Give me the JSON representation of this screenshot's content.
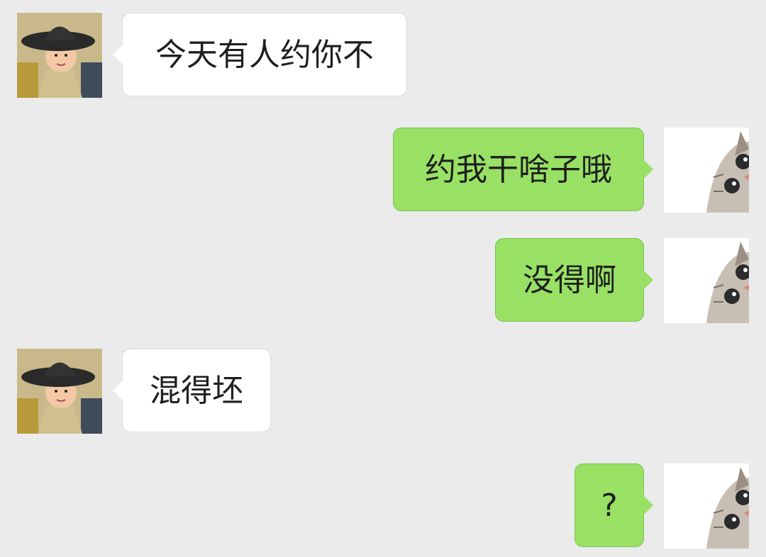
{
  "colors": {
    "background": "#ebebeb",
    "incoming_bubble": "#ffffff",
    "outgoing_bubble": "#98e165"
  },
  "messages": [
    {
      "sender": "other",
      "avatar": "boy-with-hat-avatar",
      "text": "今天有人约你不"
    },
    {
      "sender": "self",
      "avatar": "cat-avatar",
      "text": "约我干啥子哦"
    },
    {
      "sender": "self",
      "avatar": "cat-avatar",
      "text": "没得啊"
    },
    {
      "sender": "other",
      "avatar": "boy-with-hat-avatar",
      "text": "混得坯"
    },
    {
      "sender": "self",
      "avatar": "cat-avatar",
      "text": "?"
    }
  ]
}
